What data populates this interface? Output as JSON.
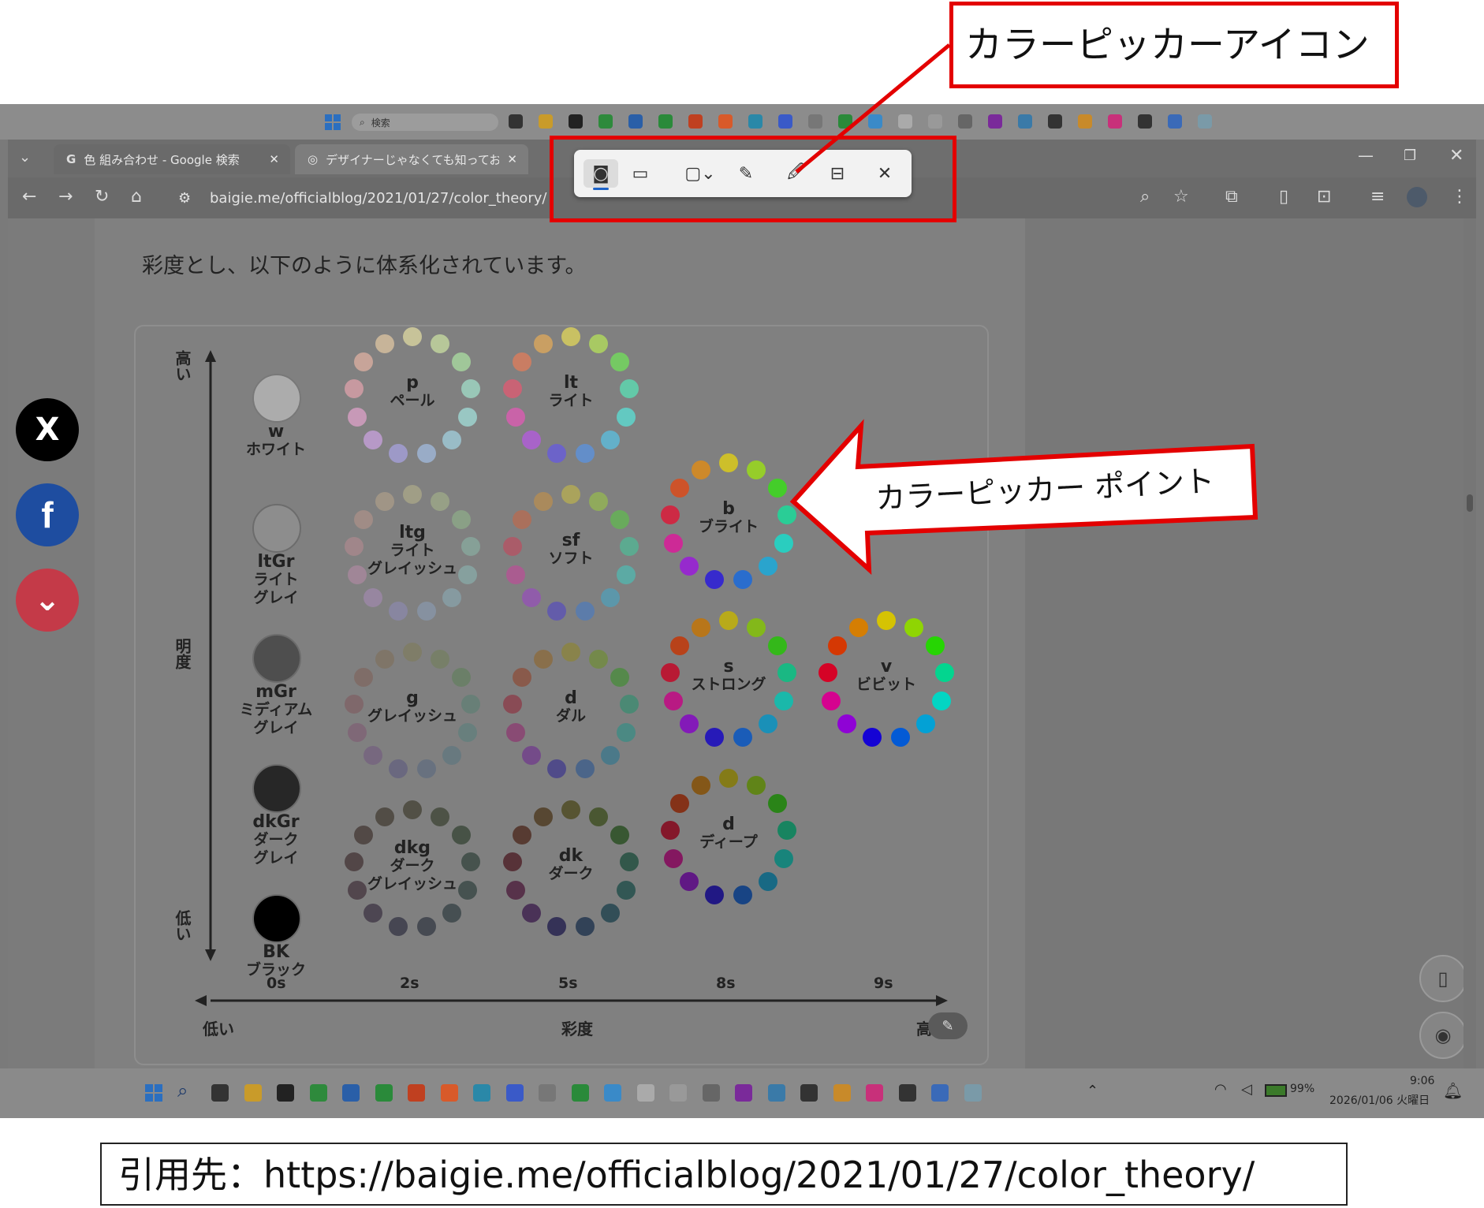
{
  "callouts": {
    "top_label": "カラーピッカーアイコン",
    "arrow_label": "カラーピッカー ポイント",
    "citation": "引用先：https://baigie.me/officialblog/2021/01/27/color_theory/"
  },
  "taskbar_top": {
    "search_placeholder": "検索"
  },
  "browser": {
    "tabs": [
      {
        "label": "色 組み合わせ - Google 検索"
      },
      {
        "label": "デザイナーじゃなくても知っておきたい"
      }
    ],
    "url": "baigie.me/officialblog/2021/01/27/color_theory/"
  },
  "article": {
    "intro_line": "彩度とし、以下のように体系化されています。"
  },
  "social": {
    "x": "X",
    "facebook": "f",
    "pocket": "⌄"
  },
  "chart_data": {
    "type": "diagram",
    "vertical_axis": {
      "label": "明度",
      "top": "高い",
      "bottom": "低い"
    },
    "horizontal_axis": {
      "label": "彩度",
      "left": "低い",
      "right": "高い",
      "ticks": [
        "0s",
        "2s",
        "5s",
        "8s",
        "9s"
      ]
    },
    "neutrals": [
      {
        "code": "w",
        "name": "ホワイト",
        "color": "#ffffff"
      },
      {
        "code": "ltGr",
        "name": "ライト グレイ",
        "color": "#bdbdbd"
      },
      {
        "code": "mGr",
        "name": "ミディアム グレイ",
        "color": "#7b7b7b"
      },
      {
        "code": "dkGr",
        "name": "ダーク グレイ",
        "color": "#3a3a3a"
      },
      {
        "code": "BK",
        "name": "ブラック",
        "color": "#000000"
      }
    ],
    "tones": [
      {
        "code": "p",
        "name": "ペール",
        "column": "2s",
        "row": 0
      },
      {
        "code": "ltg",
        "name": "ライト グレイッシュ",
        "column": "2s",
        "row": 1
      },
      {
        "code": "g",
        "name": "グレイッシュ",
        "column": "2s",
        "row": 2
      },
      {
        "code": "dkg",
        "name": "ダーク グレイッシュ",
        "column": "2s",
        "row": 3
      },
      {
        "code": "lt",
        "name": "ライト",
        "column": "5s",
        "row": 0
      },
      {
        "code": "sf",
        "name": "ソフト",
        "column": "5s",
        "row": 1
      },
      {
        "code": "d",
        "name": "ダル",
        "column": "5s",
        "row": 2
      },
      {
        "code": "dk",
        "name": "ダーク",
        "column": "5s",
        "row": 3
      },
      {
        "code": "b",
        "name": "ブライト",
        "column": "8s",
        "row": 0.8
      },
      {
        "code": "s",
        "name": "ストロング",
        "column": "8s",
        "row": 1.8
      },
      {
        "code": "d",
        "name": "ディープ",
        "column": "8s",
        "row": 2.8
      },
      {
        "code": "v",
        "name": "ビビット",
        "column": "9s",
        "row": 1.8
      }
    ]
  },
  "toolbar_tools": [
    "camera-icon",
    "video-icon",
    "region-icon",
    "edit-image-icon",
    "color-picker-icon",
    "text-extract-icon",
    "close-icon"
  ],
  "system_tray": {
    "battery": "99%",
    "time": "9:06",
    "date": "2026/01/06 火曜日"
  },
  "colors": {
    "callout_red": "#e30000"
  }
}
